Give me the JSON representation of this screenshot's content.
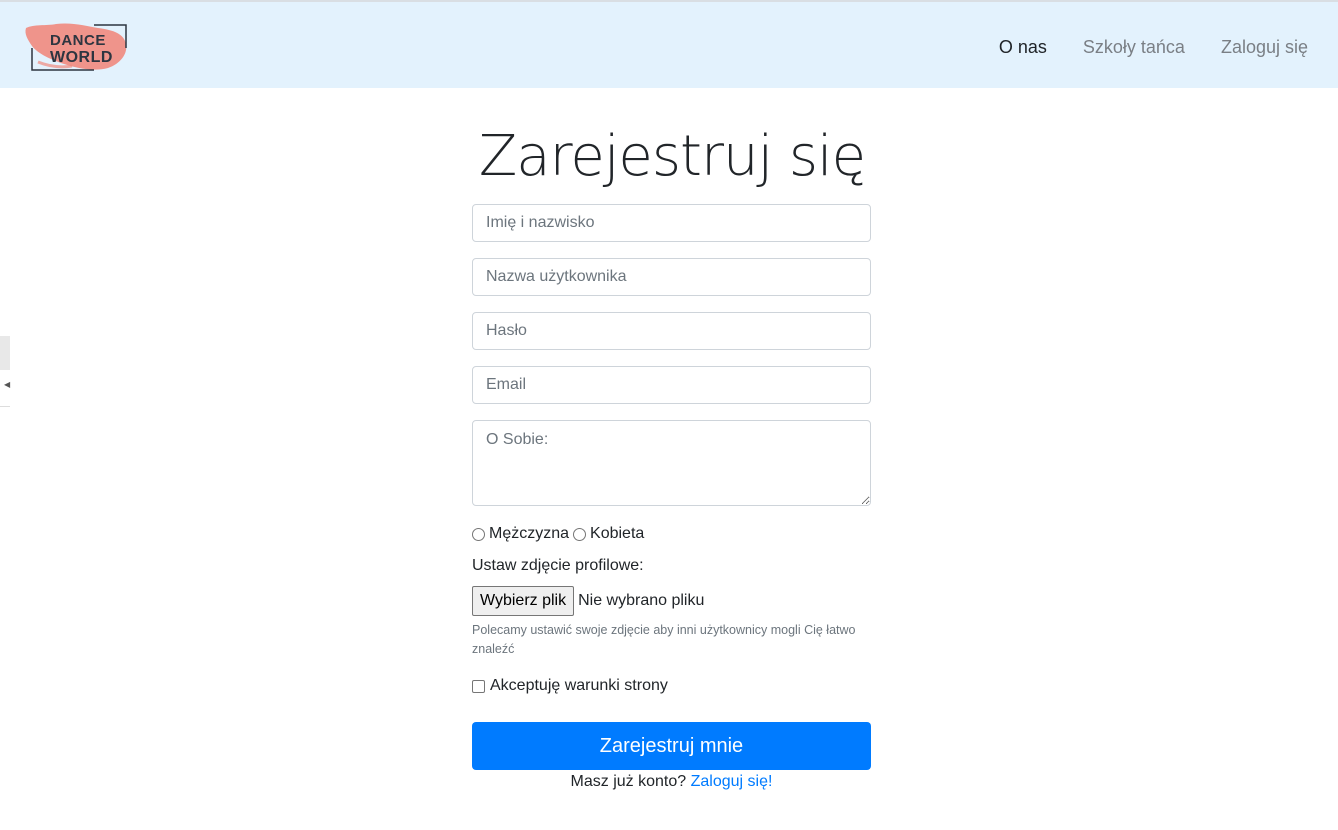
{
  "brand": {
    "logo_line1": "DANCE",
    "logo_line2": "WORLD",
    "logo_accent": "#f08a7e"
  },
  "nav": {
    "items": [
      {
        "label": "O nas",
        "active": true
      },
      {
        "label": "Szkoły tańca",
        "active": false
      },
      {
        "label": "Zaloguj się",
        "active": false
      }
    ]
  },
  "form": {
    "title": "Zarejestruj się",
    "fullname_placeholder": "Imię i nazwisko",
    "username_placeholder": "Nazwa użytkownika",
    "password_placeholder": "Hasło",
    "email_placeholder": "Email",
    "about_placeholder": "O Sobie:",
    "gender_male": "Mężczyzna",
    "gender_female": "Kobieta",
    "photo_label": "Ustaw zdjęcie profilowe:",
    "file_button": "Wybierz plik",
    "file_status": "Nie wybrano pliku",
    "photo_help": "Polecamy ustawić swoje zdjęcie aby inni użytkownicy mogli Cię łatwo znaleźć",
    "terms_label": "Akceptuję warunki strony",
    "submit_label": "Zarejestruj mnie",
    "have_account": "Masz już konto?",
    "login_link": "Zaloguj się!"
  },
  "colors": {
    "navbar_bg": "#e3f2fd",
    "primary": "#007bff"
  }
}
